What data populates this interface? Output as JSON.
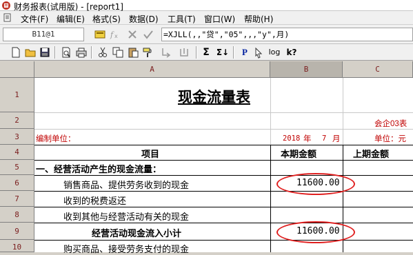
{
  "window": {
    "title": "财务报表(试用版) - [report1]"
  },
  "menu": [
    "文件(F)",
    "编辑(E)",
    "格式(S)",
    "数据(D)",
    "工具(T)",
    "窗口(W)",
    "帮助(H)"
  ],
  "formula_bar": {
    "cell_ref": "B11@1",
    "formula": "=XJLL(,,\"贷\",\"05\",,,\"y\",月)"
  },
  "toolbar": {
    "icons": [
      "new-icon",
      "open-icon",
      "save-icon",
      "print-preview-icon",
      "print-icon",
      "cut-icon",
      "copy-icon",
      "paste-icon",
      "format-painter-icon",
      "sum-icon",
      "sum-formula-icon",
      "page-icon",
      "cursor-icon",
      "log-icon",
      "help-icon"
    ],
    "sum_label": "Σ",
    "sum2_label": "Σ↓",
    "p_label": "P",
    "log_label": "log",
    "help_label": "k?"
  },
  "columns": [
    "A",
    "B",
    "C"
  ],
  "rows": [
    "1",
    "2",
    "3",
    "4",
    "5",
    "6",
    "7",
    "8",
    "9",
    "10"
  ],
  "report": {
    "title": "现金流量表",
    "form_no": "会企03表",
    "unit_label": "编制单位：",
    "period_year": "2018",
    "period_year_unit": "年",
    "period_month": "7",
    "period_month_unit": "月",
    "currency": "单位：元",
    "headers": {
      "item": "项目",
      "current": "本期金额",
      "prior": "上期金额"
    },
    "lines": [
      {
        "label": "一、经营活动产生的现金流量：",
        "current": "",
        "prior": ""
      },
      {
        "label": "销售商品、提供劳务收到的现金",
        "current": "11600.00",
        "prior": ""
      },
      {
        "label": "收到的税费返还",
        "current": "",
        "prior": ""
      },
      {
        "label": "收到其他与经营活动有关的现金",
        "current": "",
        "prior": ""
      },
      {
        "label": "经营活动现金流入小计",
        "current": "11600.00",
        "prior": ""
      },
      {
        "label": "购买商品、接受劳务支付的现金",
        "current": "",
        "prior": ""
      }
    ]
  },
  "colors": {
    "highlight": "#e02020",
    "header_text": "#7a1d1d",
    "red_text": "#c00000"
  }
}
